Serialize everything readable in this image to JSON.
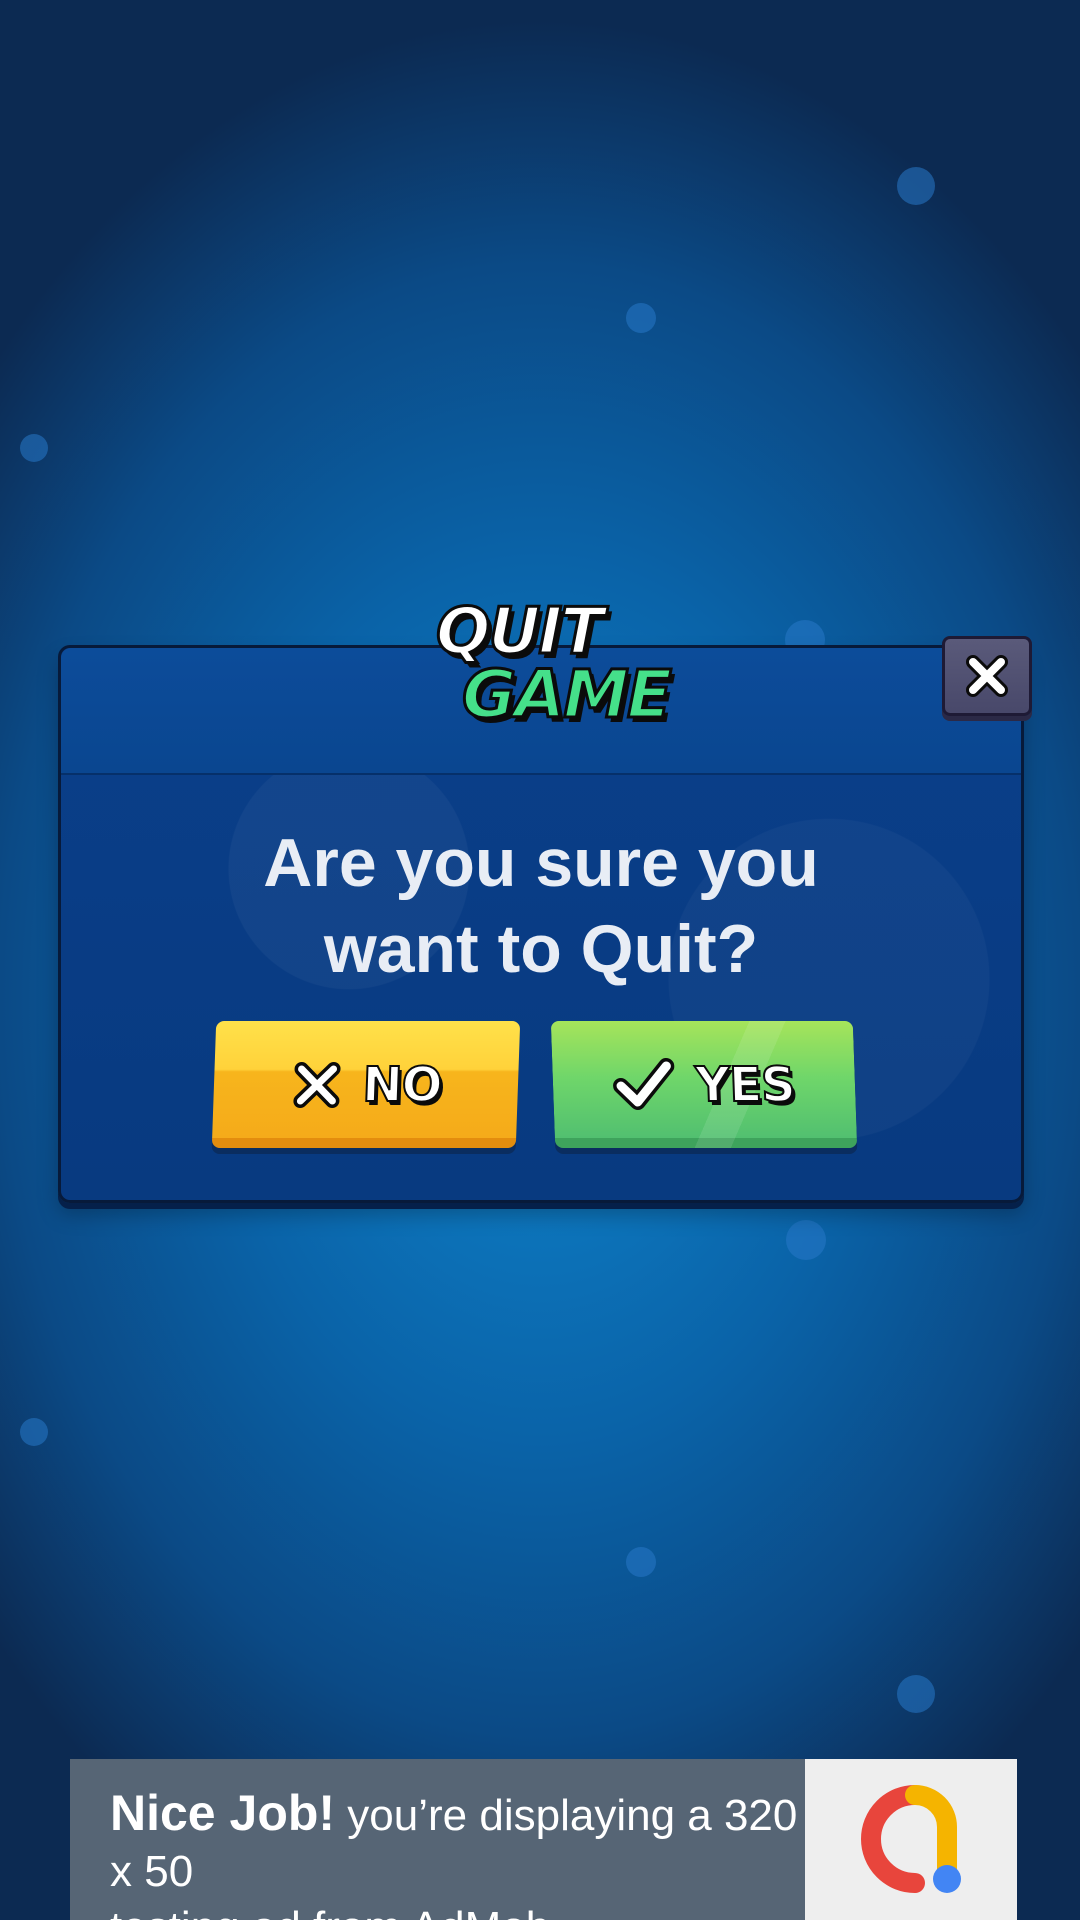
{
  "dialog": {
    "title_line_1": "QUIT",
    "title_line_2": "GAME",
    "question_line_1": "Are you sure you",
    "question_line_2": "want to Quit?",
    "no_label": "NO",
    "yes_label": "YES"
  },
  "ad": {
    "headline": "Nice Job!",
    "body_line_1": "you’re displaying a 320 x 50",
    "body_line_2": "testing ad from AdMob."
  },
  "colors": {
    "title_accent": "#45e08a",
    "no_button": "#f5ab1a",
    "yes_button": "#52c070",
    "close_button": "#48486a"
  },
  "icons": {
    "close": "close-icon",
    "no": "x-icon",
    "yes": "checkmark-icon",
    "ad_logo": "admob-logo"
  }
}
